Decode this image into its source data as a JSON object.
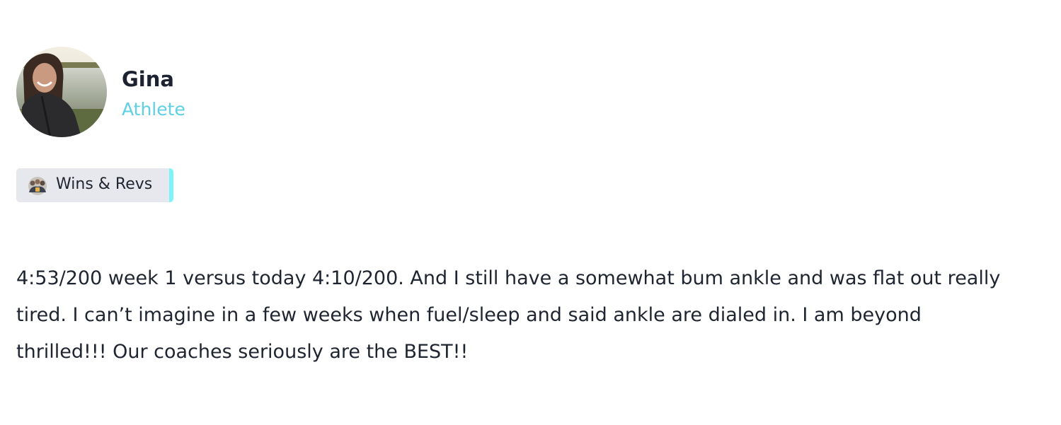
{
  "author": {
    "name": "Gina",
    "role": "Athlete"
  },
  "category": {
    "label": "Wins & Revs",
    "accent_color": "#7cf4fa"
  },
  "post": {
    "body": "4:53/200 week 1 versus today 4:10/200. And I still have a somewhat bum ankle and was flat out really tired. I can’t imagine in a few weeks when fuel/sleep and said ankle are dialed in. I am beyond thrilled!!! Our coaches seriously are the BEST!!"
  },
  "colors": {
    "role_text": "#5fcfe6",
    "chip_background": "#e6e8ed",
    "text": "#1f2530"
  }
}
